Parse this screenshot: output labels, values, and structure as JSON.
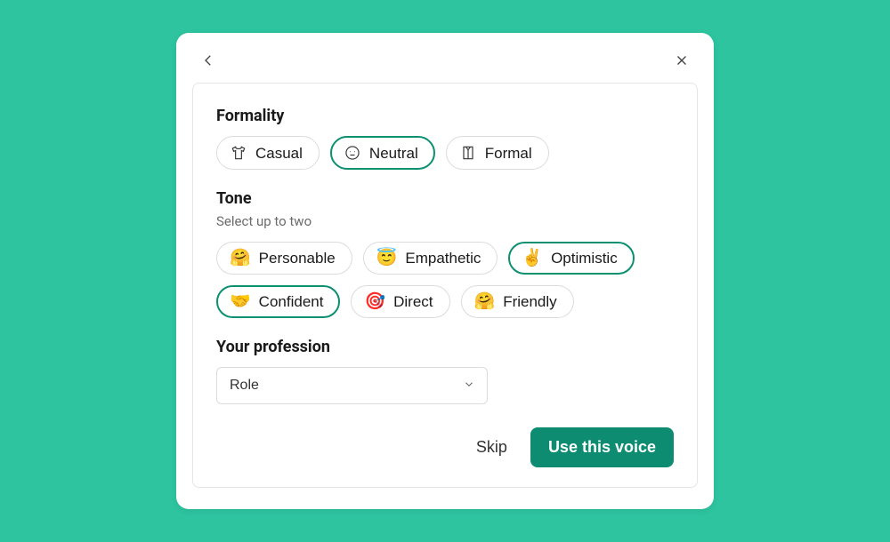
{
  "formality": {
    "title": "Formality",
    "options": [
      {
        "id": "casual",
        "label": "Casual",
        "selected": false
      },
      {
        "id": "neutral",
        "label": "Neutral",
        "selected": true
      },
      {
        "id": "formal",
        "label": "Formal",
        "selected": false
      }
    ]
  },
  "tone": {
    "title": "Tone",
    "subtitle": "Select up to two",
    "options": [
      {
        "id": "personable",
        "label": "Personable",
        "emoji": "🤗",
        "selected": false
      },
      {
        "id": "empathetic",
        "label": "Empathetic",
        "emoji": "😇",
        "selected": false
      },
      {
        "id": "optimistic",
        "label": "Optimistic",
        "emoji": "✌️",
        "selected": true
      },
      {
        "id": "confident",
        "label": "Confident",
        "emoji": "🤝",
        "selected": true
      },
      {
        "id": "direct",
        "label": "Direct",
        "emoji": "🎯",
        "selected": false
      },
      {
        "id": "friendly",
        "label": "Friendly",
        "emoji": "🤗",
        "selected": false
      }
    ]
  },
  "profession": {
    "title": "Your profession",
    "placeholder": "Role"
  },
  "actions": {
    "skip": "Skip",
    "primary": "Use this voice"
  }
}
